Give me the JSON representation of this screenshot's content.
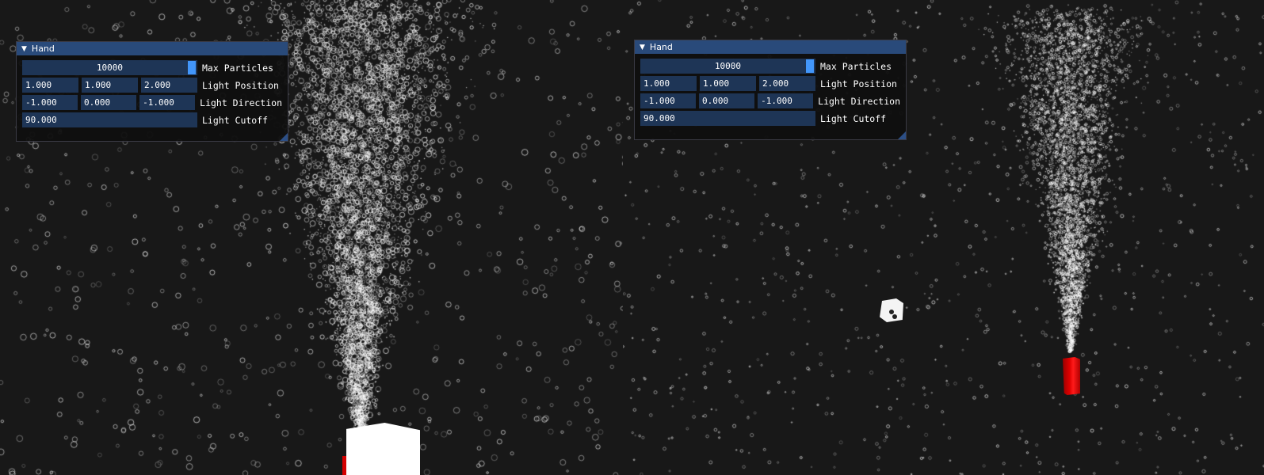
{
  "panels": [
    {
      "window": {
        "title": "Hand",
        "max_particles": {
          "value": "10000",
          "label": "Max Particles"
        },
        "light_position": {
          "values": [
            "1.000",
            "1.000",
            "2.000"
          ],
          "label": "Light Position"
        },
        "light_direction": {
          "values": [
            "-1.000",
            "0.000",
            "-1.000"
          ],
          "label": "Light Direction"
        },
        "light_cutoff": {
          "value": "90.000",
          "label": "Light Cutoff"
        }
      }
    },
    {
      "window": {
        "title": "Hand",
        "max_particles": {
          "value": "10000",
          "label": "Max Particles"
        },
        "light_position": {
          "values": [
            "1.000",
            "1.000",
            "2.000"
          ],
          "label": "Light Position"
        },
        "light_direction": {
          "values": [
            "-1.000",
            "0.000",
            "-1.000"
          ],
          "label": "Light Direction"
        },
        "light_cutoff": {
          "value": "90.000",
          "label": "Light Cutoff"
        }
      }
    }
  ],
  "colors": {
    "background": "#181818",
    "title_bar": "#294a7a",
    "frame": "#1e3556",
    "slider_grab": "#4296fa",
    "particle": "#ffffff",
    "cube_red": "#d40000"
  },
  "icons": {
    "collapse": "triangle-down-icon"
  }
}
